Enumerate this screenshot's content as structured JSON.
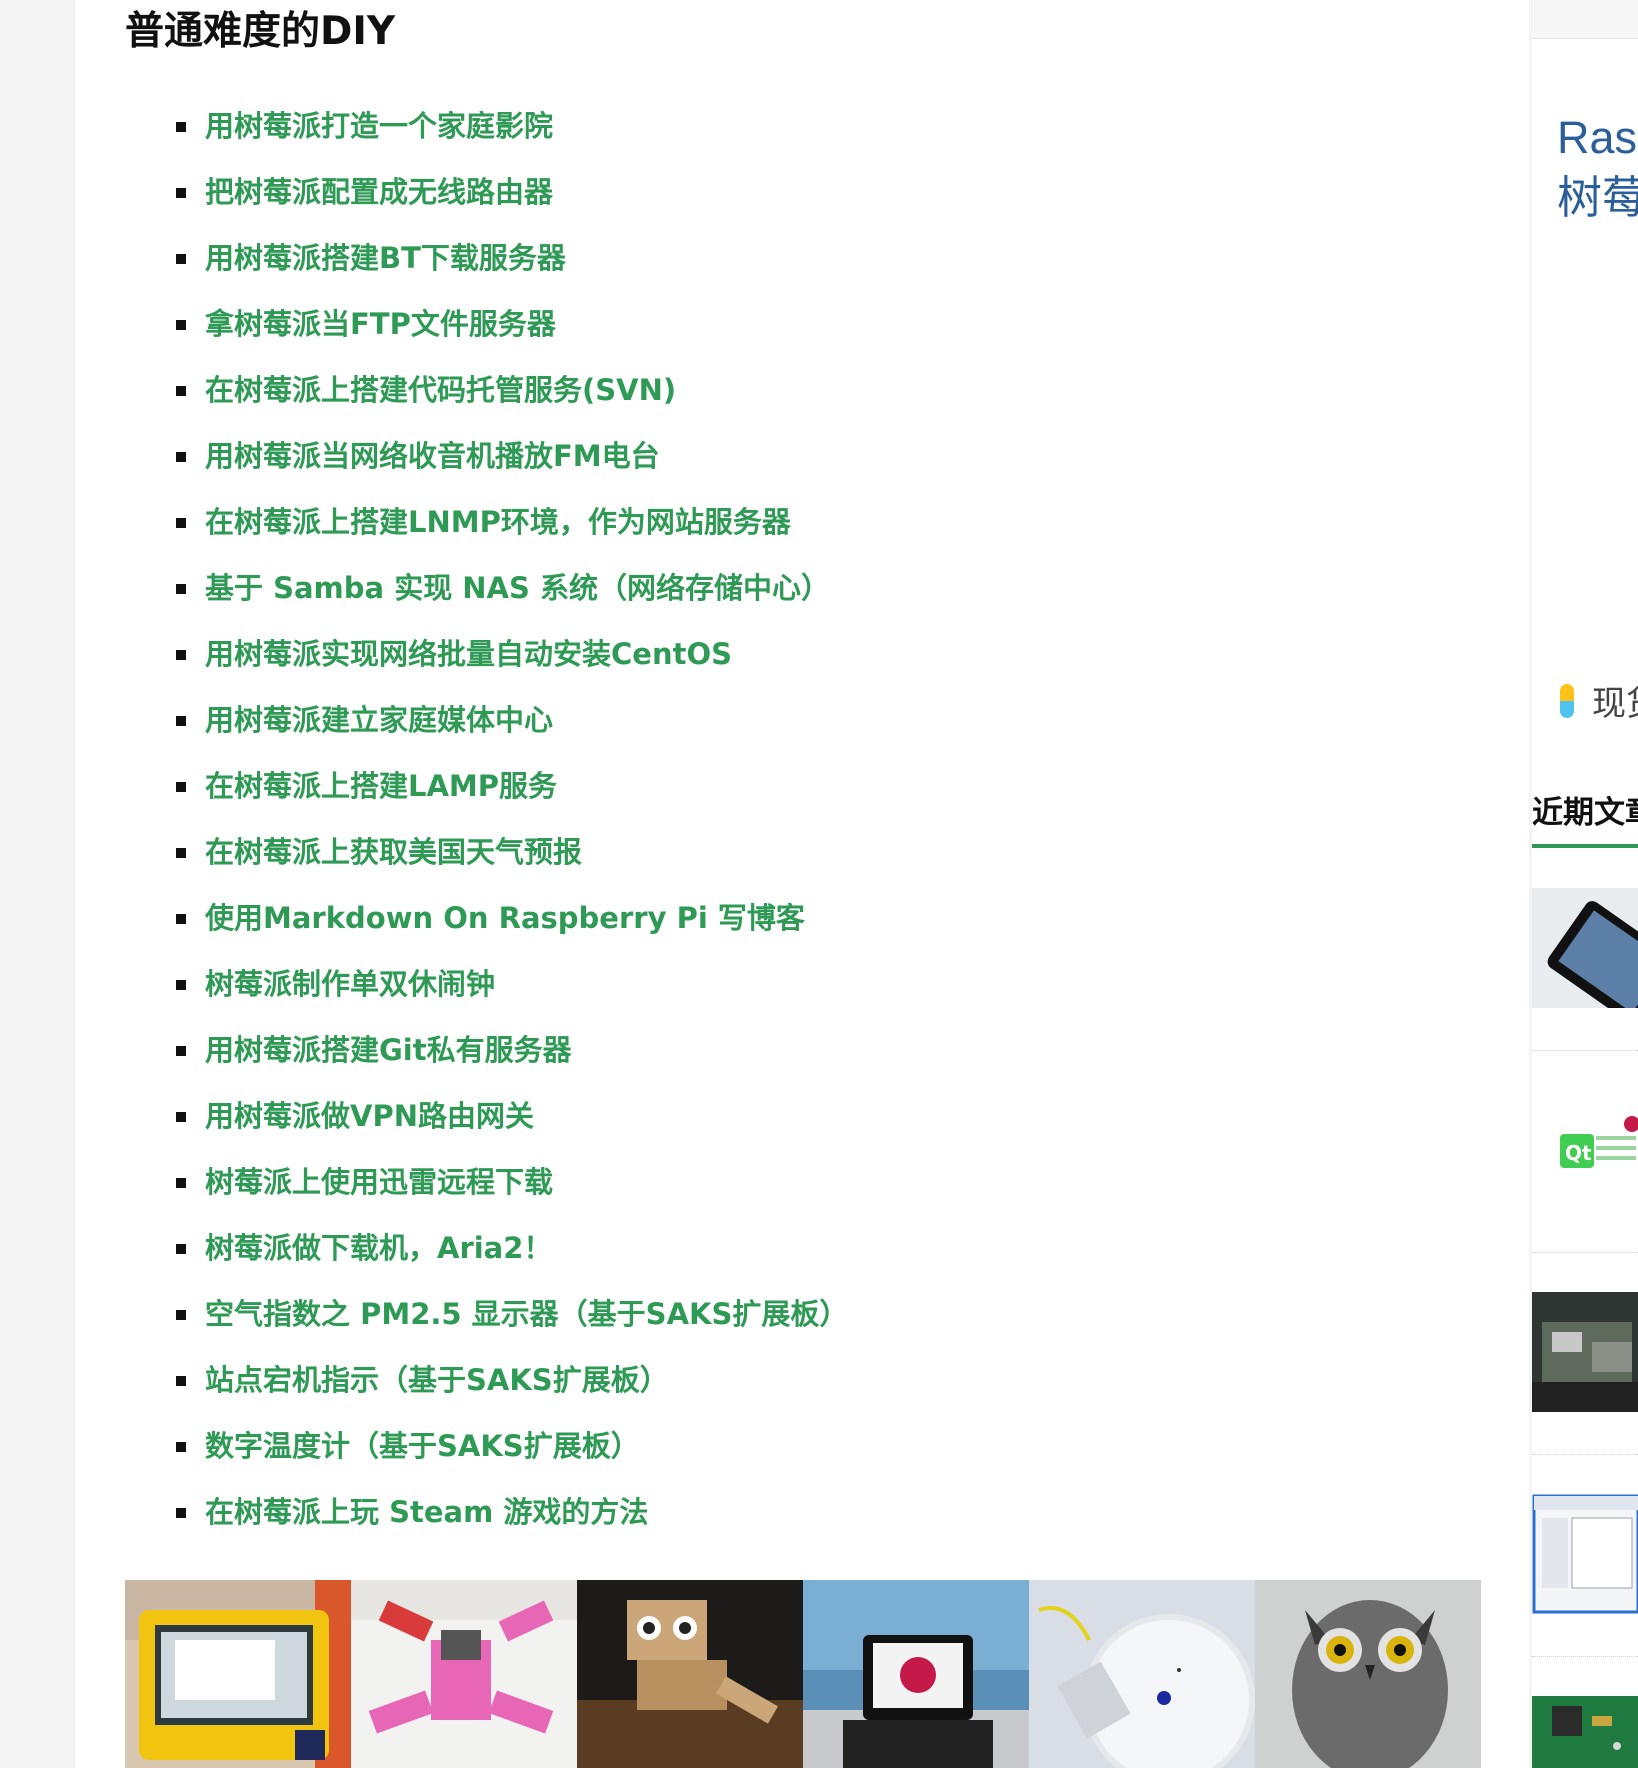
{
  "section": {
    "title": "普通难度的DIY"
  },
  "diy_items": [
    "用树莓派打造一个家庭影院",
    "把树莓派配置成无线路由器",
    "用树莓派搭建BT下载服务器",
    "拿树莓派当FTP文件服务器",
    "在树莓派上搭建代码托管服务(SVN)",
    "用树莓派当网络收音机播放FM电台",
    "在树莓派上搭建LNMP环境，作为网站服务器",
    "基于 Samba 实现 NAS 系统（网络存储中心）",
    "用树莓派实现网络批量自动安装CentOS",
    "用树莓派建立家庭媒体中心",
    "在树莓派上搭建LAMP服务",
    "在树莓派上获取美国天气预报",
    "使用Markdown On Raspberry Pi 写博客",
    "树莓派制作单双休闹钟",
    "用树莓派搭建Git私有服务器",
    "用树莓派做VPN路由网关",
    "树莓派上使用迅雷远程下载",
    "树莓派做下载机，Aria2！",
    "空气指数之 PM2.5 显示器（基于SAKS扩展板）",
    "站点宕机指示（基于SAKS扩展板）",
    "数字温度计（基于SAKS扩展板）",
    "在树莓派上玩 Steam 游戏的方法"
  ],
  "gallery": [
    "tablet-photo",
    "robot-spider-photo",
    "robot-cat-photo",
    "laptop-pi-photo",
    "camera-device-photo",
    "owl-photo"
  ],
  "sidebar": {
    "promo_line1": "Ras",
    "promo_line2": "树莓",
    "spot_text": "现货",
    "recent_heading": "近期文章"
  },
  "colors": {
    "link": "#2e9a55",
    "accent_green": "#2e9a55",
    "promo_blue": "#2c5f9a"
  }
}
